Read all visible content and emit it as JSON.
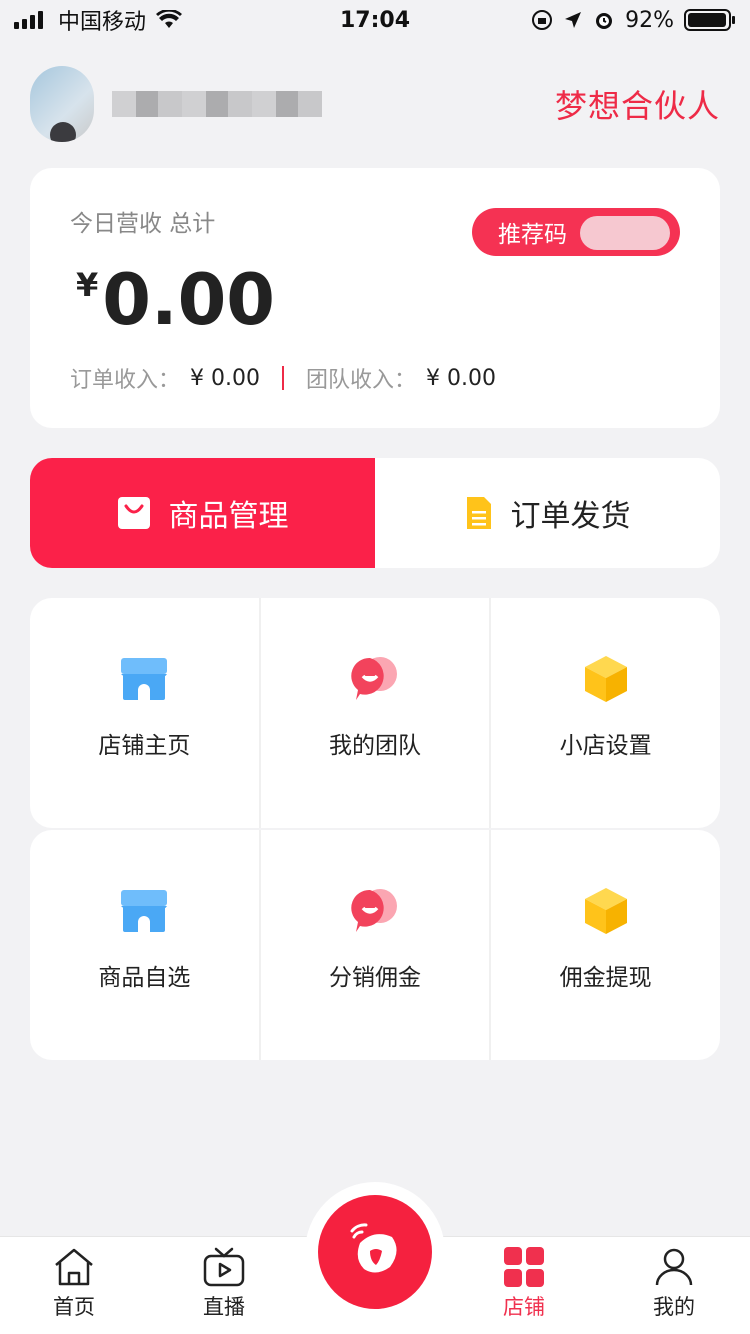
{
  "status_bar": {
    "carrier": "中国移动",
    "time": "17:04",
    "battery": "92%"
  },
  "header": {
    "partner_title": "梦想合伙人"
  },
  "revenue": {
    "label": "今日营收 总计",
    "referral_label": "推荐码",
    "currency": "¥",
    "amount": "0.00",
    "order_income_label": "订单收入：",
    "order_income_value": "¥ 0.00",
    "team_income_label": "团队收入：",
    "team_income_value": "¥ 0.00"
  },
  "actions": {
    "product_management": "商品管理",
    "order_shipping": "订单发货"
  },
  "grid": {
    "row1": [
      "店铺主页",
      "我的团队",
      "小店设置"
    ],
    "row2": [
      "商品自选",
      "分销佣金",
      "佣金提现"
    ]
  },
  "tabbar": {
    "home": "首页",
    "live": "直播",
    "shop": "店铺",
    "me": "我的"
  },
  "colors": {
    "accent": "#fb2149",
    "partner_text": "#ee2b47",
    "blue_icon": "#4aa8f5",
    "yellow_icon": "#ffc31a"
  },
  "icons": {
    "shop": "storefront-icon",
    "team": "chat-bubble-icon",
    "settings": "cube-icon",
    "bag": "shopping-bag-icon",
    "doc": "document-icon"
  }
}
